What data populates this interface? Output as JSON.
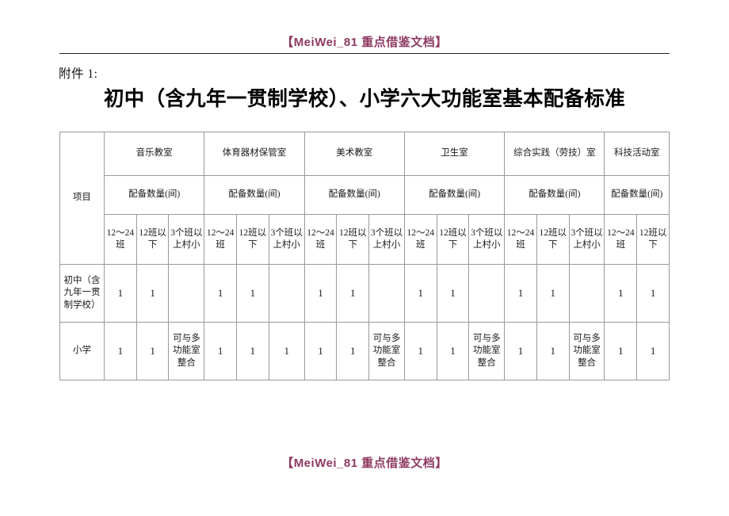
{
  "watermark": {
    "header_text": "【MeiWei_81 重点借鉴文档】",
    "footer_text": "【MeiWei_81 重点借鉴文档】",
    "color": "#8e3a62"
  },
  "attachment_label": "附件 1:",
  "title": "初中（含九年一贯制学校）、小学六大功能室基本配备标准",
  "table": {
    "item_header": "项目",
    "quantity_header": "配备数量(间)",
    "groups": [
      {
        "name": "音乐教室",
        "quantity_label": "配备数量(间)",
        "columns": [
          "12～24班",
          "12班以下",
          "3个班以上村小"
        ]
      },
      {
        "name": "体育器材保管室",
        "quantity_label": "配备数量(间)",
        "columns": [
          "12～24班",
          "12班以下",
          "3个班以上村小"
        ]
      },
      {
        "name": "美术教室",
        "quantity_label": "配备数量(间)",
        "columns": [
          "12～24班",
          "12班以下",
          "3个班以上村小"
        ]
      },
      {
        "name": "卫生室",
        "quantity_label": "配备数量(间)",
        "columns": [
          "12～24班",
          "12班以下",
          "3个班以上村小"
        ]
      },
      {
        "name": "综合实践（劳技）室",
        "quantity_label": "配备数量(间)",
        "columns": [
          "12～24班",
          "12班以下",
          "3个班以上村小"
        ]
      },
      {
        "name": "科技活动室",
        "quantity_label": "配备数量(间)",
        "columns": [
          "12～24班",
          "12班以下"
        ]
      }
    ],
    "rows": [
      {
        "label": "初中（含九年一贯制学校）",
        "values": [
          "1",
          "1",
          "",
          "1",
          "1",
          "",
          "1",
          "1",
          "",
          "1",
          "1",
          "",
          "1",
          "1",
          "",
          "1",
          "1"
        ]
      },
      {
        "label": "小学",
        "values": [
          "1",
          "1",
          "可与多功能室整合",
          "1",
          "1",
          "1",
          "1",
          "1",
          "可与多功能室整合",
          "1",
          "1",
          "可与多功能室整合",
          "1",
          "1",
          "可与多功能室整合",
          "1",
          "1"
        ]
      }
    ]
  }
}
